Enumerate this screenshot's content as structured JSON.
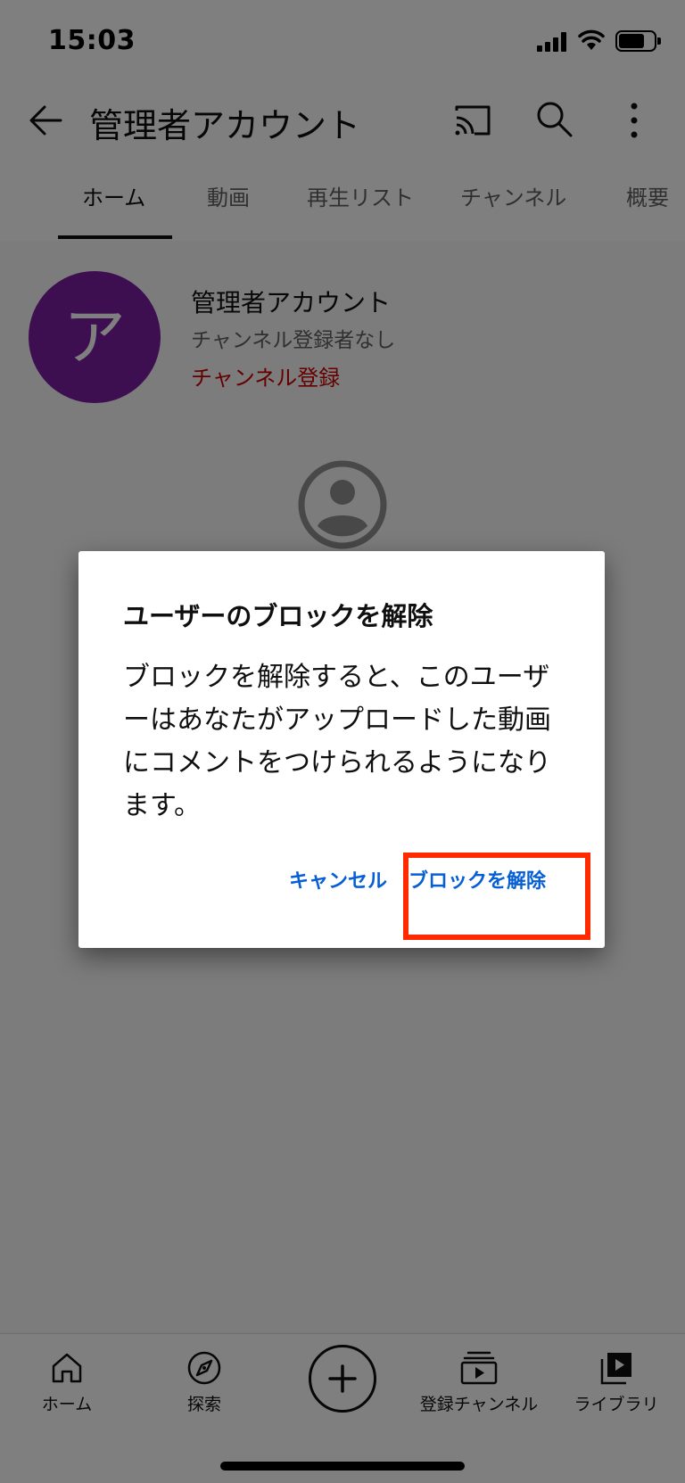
{
  "status_bar": {
    "time": "15:03",
    "battery_level": 0.75
  },
  "header": {
    "title": "管理者アカウント"
  },
  "tabs": [
    {
      "label": "ホーム",
      "active": true
    },
    {
      "label": "動画"
    },
    {
      "label": "再生リスト"
    },
    {
      "label": "チャンネル"
    },
    {
      "label": "概要"
    }
  ],
  "channel": {
    "avatar_letter": "ア",
    "avatar_color": "#7c1fa0",
    "name": "管理者アカウント",
    "subscribers": "チャンネル登録者なし",
    "subscribe_label": "チャンネル登録"
  },
  "dialog": {
    "title": "ユーザーのブロックを解除",
    "body": "ブロックを解除すると、このユーザーはあなたがアップロードした動画にコメントをつけられるようになります。",
    "cancel_label": "キャンセル",
    "unblock_label": "ブロックを解除"
  },
  "bottom_nav": [
    {
      "label": "ホーム",
      "icon": "home-icon"
    },
    {
      "label": "探索",
      "icon": "explore-icon"
    },
    {
      "label": "",
      "icon": "create-icon"
    },
    {
      "label": "登録チャンネル",
      "icon": "subscriptions-icon"
    },
    {
      "label": "ライブラリ",
      "icon": "library-icon"
    }
  ],
  "colors": {
    "accent": "#065fd4",
    "subscribe": "#cc0000",
    "highlight": "#ff2a00"
  }
}
